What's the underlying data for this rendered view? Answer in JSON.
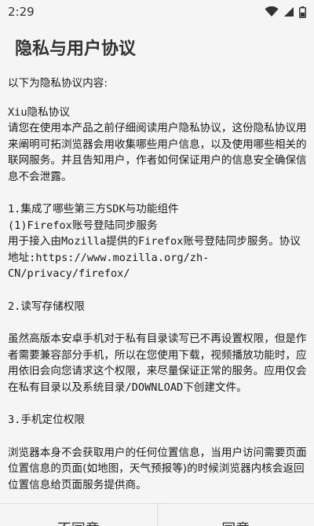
{
  "status_bar": {
    "time": "2:29",
    "icons": [
      "wifi-icon",
      "signal-icon",
      "battery-icon"
    ]
  },
  "dialog": {
    "title": "隐私与用户协议",
    "intro": "以下为隐私协议内容:",
    "heading": "Xiu隐私协议",
    "paragraph1": "请您在使用本产品之前仔细阅读用户隐私协议，这份隐私协议用来阐明可拓浏览器会用收集哪些用户信息，以及使用哪些相关的联网服务。并且告知用户，作者如何保证用户的信息安全确保信息不会泄露。",
    "section1_title": "1.集成了哪些第三方SDK与功能组件",
    "section1_sub": "(1)Firefox账号登陆同步服务",
    "section1_body": "用于接入由Mozilla提供的Firefox账号登陆同步服务。协议地址:https://www.mozilla.org/zh-CN/privacy/firefox/",
    "section2_title": "2.读写存储权限",
    "section2_body": "虽然高版本安卓手机对于私有目录读写已不再设置权限，但是作者需要兼容部分手机，所以在您使用下载，视频播放功能时，应用依旧会向您请求这个权限，来尽量保证正常的服务。应用仅会在私有目录以及系统目录/DOWNLOAD下创建文件。",
    "section3_title": "3.手机定位权限",
    "section3_body": "浏览器本身不会获取用户的任何位置信息，当用户访问需要页面位置信息的页面(如地图，天气预报等)的时候浏览器内核会返回位置信息给页面服务提供商。"
  },
  "buttons": {
    "disagree": "不同意",
    "agree": "同意"
  }
}
